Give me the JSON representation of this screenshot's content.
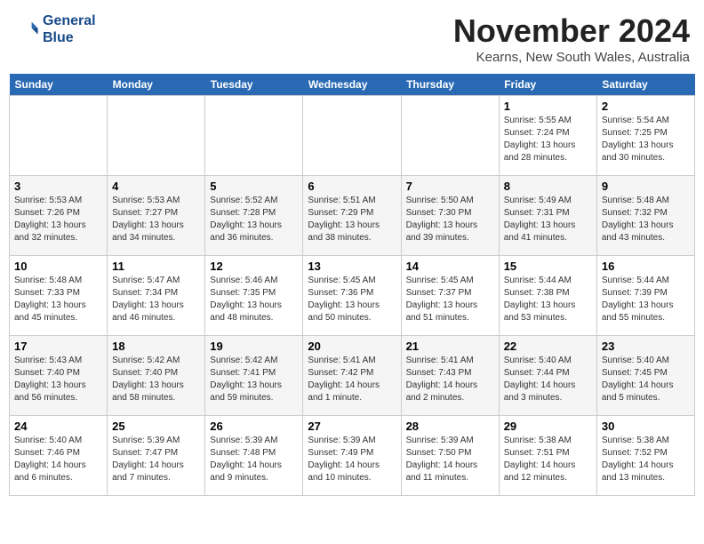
{
  "header": {
    "logo_line1": "General",
    "logo_line2": "Blue",
    "month_title": "November 2024",
    "location": "Kearns, New South Wales, Australia"
  },
  "weekdays": [
    "Sunday",
    "Monday",
    "Tuesday",
    "Wednesday",
    "Thursday",
    "Friday",
    "Saturday"
  ],
  "weeks": [
    [
      {
        "day": "",
        "info": ""
      },
      {
        "day": "",
        "info": ""
      },
      {
        "day": "",
        "info": ""
      },
      {
        "day": "",
        "info": ""
      },
      {
        "day": "",
        "info": ""
      },
      {
        "day": "1",
        "info": "Sunrise: 5:55 AM\nSunset: 7:24 PM\nDaylight: 13 hours\nand 28 minutes."
      },
      {
        "day": "2",
        "info": "Sunrise: 5:54 AM\nSunset: 7:25 PM\nDaylight: 13 hours\nand 30 minutes."
      }
    ],
    [
      {
        "day": "3",
        "info": "Sunrise: 5:53 AM\nSunset: 7:26 PM\nDaylight: 13 hours\nand 32 minutes."
      },
      {
        "day": "4",
        "info": "Sunrise: 5:53 AM\nSunset: 7:27 PM\nDaylight: 13 hours\nand 34 minutes."
      },
      {
        "day": "5",
        "info": "Sunrise: 5:52 AM\nSunset: 7:28 PM\nDaylight: 13 hours\nand 36 minutes."
      },
      {
        "day": "6",
        "info": "Sunrise: 5:51 AM\nSunset: 7:29 PM\nDaylight: 13 hours\nand 38 minutes."
      },
      {
        "day": "7",
        "info": "Sunrise: 5:50 AM\nSunset: 7:30 PM\nDaylight: 13 hours\nand 39 minutes."
      },
      {
        "day": "8",
        "info": "Sunrise: 5:49 AM\nSunset: 7:31 PM\nDaylight: 13 hours\nand 41 minutes."
      },
      {
        "day": "9",
        "info": "Sunrise: 5:48 AM\nSunset: 7:32 PM\nDaylight: 13 hours\nand 43 minutes."
      }
    ],
    [
      {
        "day": "10",
        "info": "Sunrise: 5:48 AM\nSunset: 7:33 PM\nDaylight: 13 hours\nand 45 minutes."
      },
      {
        "day": "11",
        "info": "Sunrise: 5:47 AM\nSunset: 7:34 PM\nDaylight: 13 hours\nand 46 minutes."
      },
      {
        "day": "12",
        "info": "Sunrise: 5:46 AM\nSunset: 7:35 PM\nDaylight: 13 hours\nand 48 minutes."
      },
      {
        "day": "13",
        "info": "Sunrise: 5:45 AM\nSunset: 7:36 PM\nDaylight: 13 hours\nand 50 minutes."
      },
      {
        "day": "14",
        "info": "Sunrise: 5:45 AM\nSunset: 7:37 PM\nDaylight: 13 hours\nand 51 minutes."
      },
      {
        "day": "15",
        "info": "Sunrise: 5:44 AM\nSunset: 7:38 PM\nDaylight: 13 hours\nand 53 minutes."
      },
      {
        "day": "16",
        "info": "Sunrise: 5:44 AM\nSunset: 7:39 PM\nDaylight: 13 hours\nand 55 minutes."
      }
    ],
    [
      {
        "day": "17",
        "info": "Sunrise: 5:43 AM\nSunset: 7:40 PM\nDaylight: 13 hours\nand 56 minutes."
      },
      {
        "day": "18",
        "info": "Sunrise: 5:42 AM\nSunset: 7:40 PM\nDaylight: 13 hours\nand 58 minutes."
      },
      {
        "day": "19",
        "info": "Sunrise: 5:42 AM\nSunset: 7:41 PM\nDaylight: 13 hours\nand 59 minutes."
      },
      {
        "day": "20",
        "info": "Sunrise: 5:41 AM\nSunset: 7:42 PM\nDaylight: 14 hours\nand 1 minute."
      },
      {
        "day": "21",
        "info": "Sunrise: 5:41 AM\nSunset: 7:43 PM\nDaylight: 14 hours\nand 2 minutes."
      },
      {
        "day": "22",
        "info": "Sunrise: 5:40 AM\nSunset: 7:44 PM\nDaylight: 14 hours\nand 3 minutes."
      },
      {
        "day": "23",
        "info": "Sunrise: 5:40 AM\nSunset: 7:45 PM\nDaylight: 14 hours\nand 5 minutes."
      }
    ],
    [
      {
        "day": "24",
        "info": "Sunrise: 5:40 AM\nSunset: 7:46 PM\nDaylight: 14 hours\nand 6 minutes."
      },
      {
        "day": "25",
        "info": "Sunrise: 5:39 AM\nSunset: 7:47 PM\nDaylight: 14 hours\nand 7 minutes."
      },
      {
        "day": "26",
        "info": "Sunrise: 5:39 AM\nSunset: 7:48 PM\nDaylight: 14 hours\nand 9 minutes."
      },
      {
        "day": "27",
        "info": "Sunrise: 5:39 AM\nSunset: 7:49 PM\nDaylight: 14 hours\nand 10 minutes."
      },
      {
        "day": "28",
        "info": "Sunrise: 5:39 AM\nSunset: 7:50 PM\nDaylight: 14 hours\nand 11 minutes."
      },
      {
        "day": "29",
        "info": "Sunrise: 5:38 AM\nSunset: 7:51 PM\nDaylight: 14 hours\nand 12 minutes."
      },
      {
        "day": "30",
        "info": "Sunrise: 5:38 AM\nSunset: 7:52 PM\nDaylight: 14 hours\nand 13 minutes."
      }
    ]
  ]
}
